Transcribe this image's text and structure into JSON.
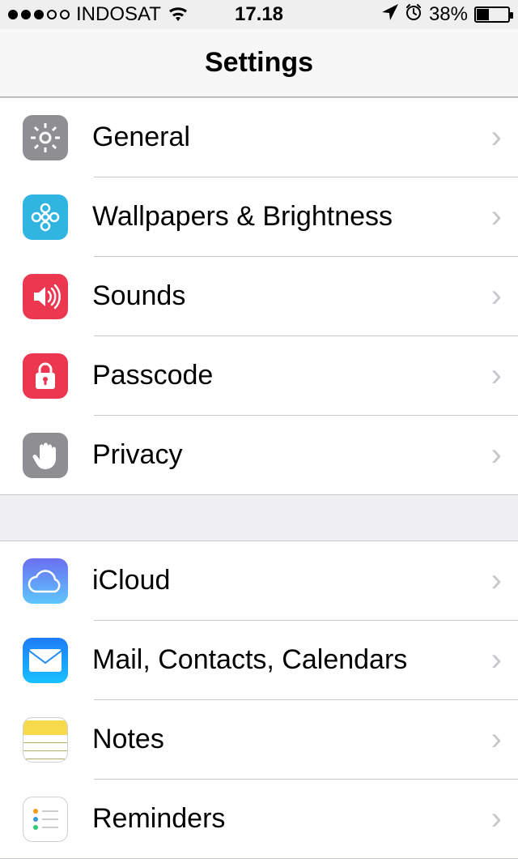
{
  "status": {
    "carrier": "INDOSAT",
    "time": "17.18",
    "battery_pct": "38%",
    "battery_level": 38
  },
  "header": {
    "title": "Settings"
  },
  "groups": [
    {
      "id": "main",
      "items": [
        {
          "id": "general",
          "icon": "gear-icon",
          "icon_class": "ic-general",
          "label": "General"
        },
        {
          "id": "wallpapers",
          "icon": "flower-icon",
          "icon_class": "ic-wallpapers",
          "label": "Wallpapers & Brightness"
        },
        {
          "id": "sounds",
          "icon": "speaker-icon",
          "icon_class": "ic-sounds",
          "label": "Sounds"
        },
        {
          "id": "passcode",
          "icon": "lock-icon",
          "icon_class": "ic-passcode",
          "label": "Passcode"
        },
        {
          "id": "privacy",
          "icon": "hand-icon",
          "icon_class": "ic-privacy",
          "label": "Privacy"
        }
      ]
    },
    {
      "id": "accounts",
      "items": [
        {
          "id": "icloud",
          "icon": "cloud-icon",
          "icon_class": "ic-icloud",
          "label": "iCloud"
        },
        {
          "id": "mail",
          "icon": "envelope-icon",
          "icon_class": "ic-mail",
          "label": "Mail, Contacts, Calendars"
        },
        {
          "id": "notes",
          "icon": "notes-icon",
          "icon_class": "ic-notes",
          "label": "Notes"
        },
        {
          "id": "reminders",
          "icon": "reminders-icon",
          "icon_class": "ic-reminders",
          "label": "Reminders"
        }
      ]
    }
  ]
}
